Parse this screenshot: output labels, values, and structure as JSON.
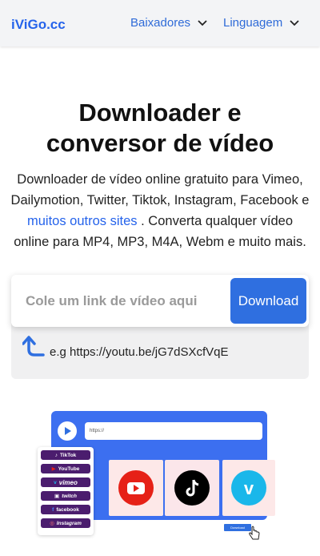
{
  "header": {
    "logo": "iViGo.cc",
    "nav": [
      {
        "label": "Baixadores",
        "icon": "chevron-down-icon"
      },
      {
        "label": "Linguagem",
        "icon": "chevron-down-icon"
      }
    ]
  },
  "hero": {
    "title_line1": "Downloader e",
    "title_line2": "conversor de vídeo",
    "desc_line1": "Downloader de vídeo online gratuito para Vimeo,",
    "desc_line2": "Dailymotion, Twitter, Tiktok, Instagram, Facebook e",
    "desc_link": "muitos outros sites",
    "desc_line3_rest": " . Converta qualquer vídeo",
    "desc_line4": "online para MP4, MP3, M4A, Webm e muito mais."
  },
  "search": {
    "placeholder": "Cole um link de vídeo aqui",
    "value": "",
    "button_label": "Download",
    "example": "e.g https://youtu.be/jG7dSXcfVqE"
  },
  "illustration": {
    "url_text": "https://",
    "platforms": [
      "TikTok",
      "YouTube",
      "vimeo",
      "twitch",
      "facebook",
      "Instagram"
    ],
    "download_label": "Download",
    "colors": {
      "accent": "#2f6fe0",
      "youtube": "#e62117",
      "tiktok": "#000000",
      "vimeo": "#1ab7ea"
    }
  }
}
